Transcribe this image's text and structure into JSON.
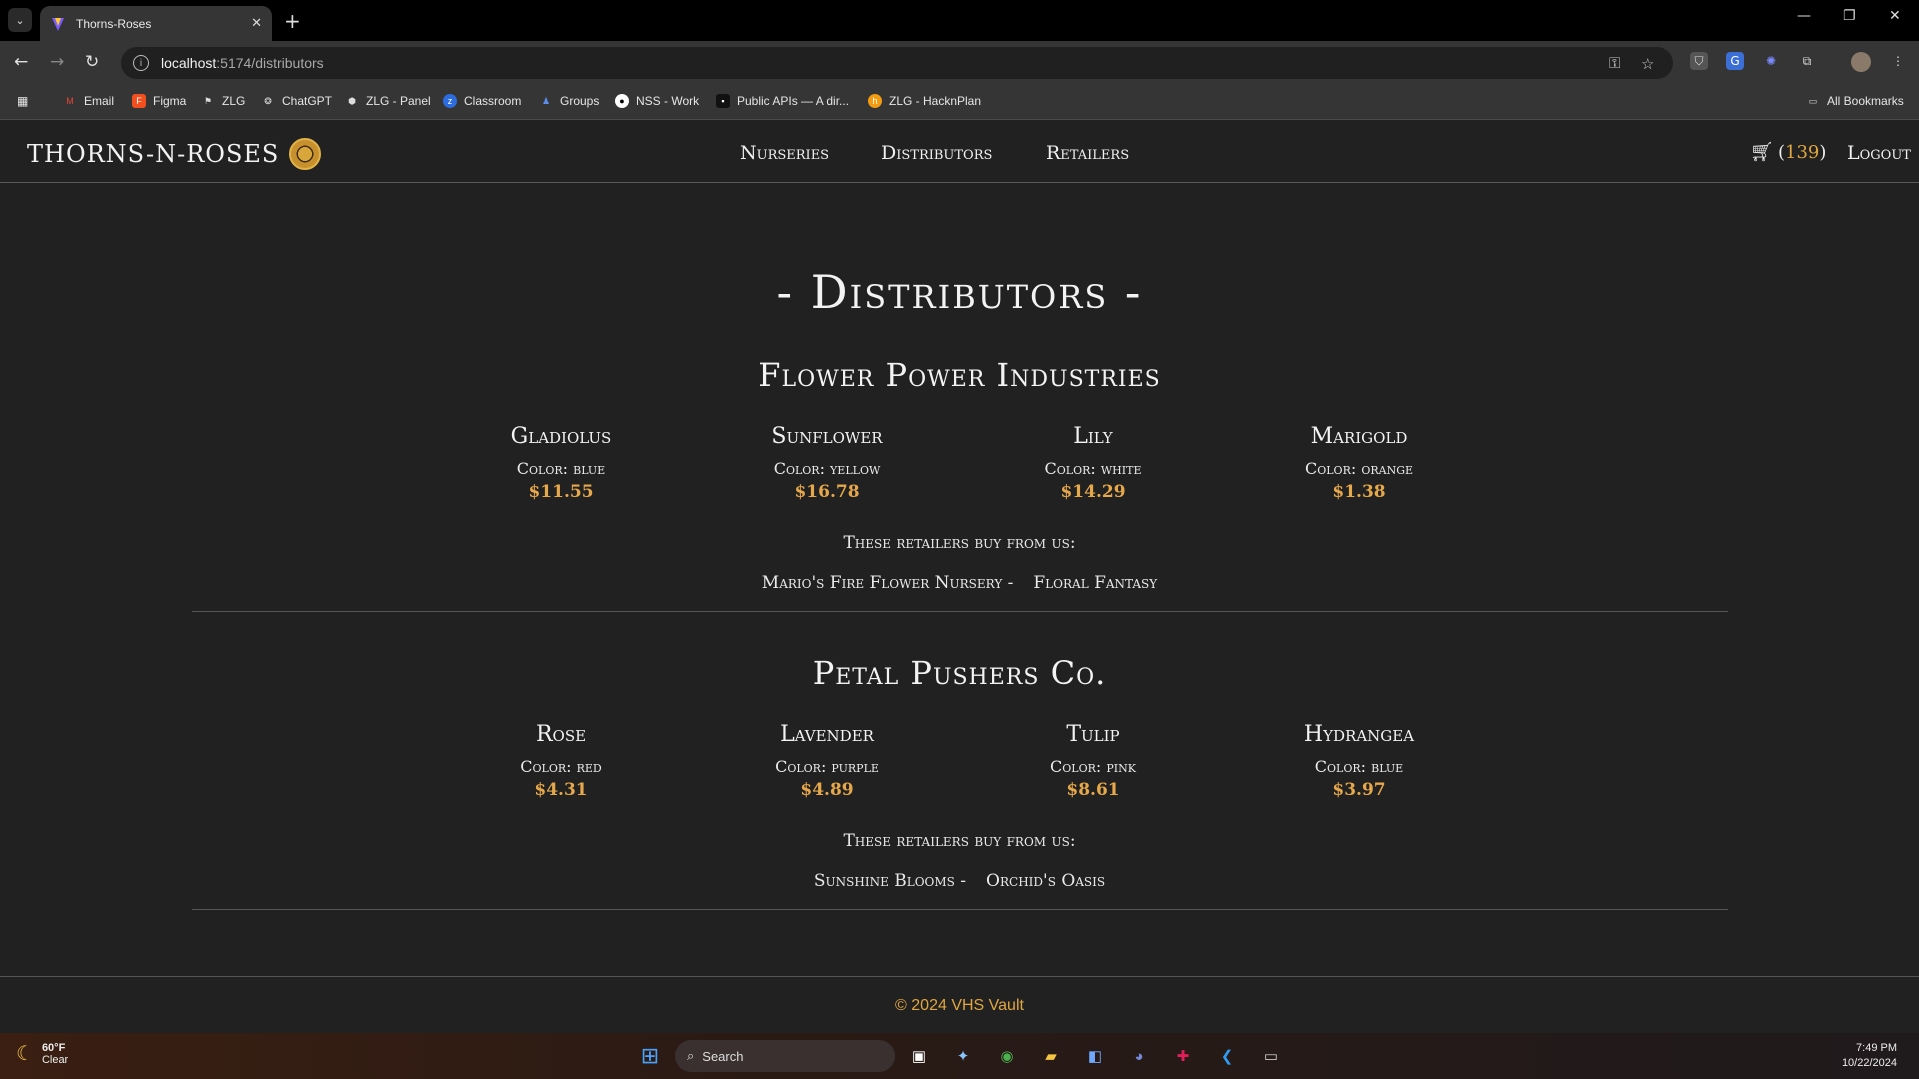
{
  "browser": {
    "tab_title": "Thorns-Roses",
    "url_host": "localhost",
    "url_path": ":5174/distributors",
    "bookmarks": [
      "Email",
      "Figma",
      "ZLG",
      "ChatGPT",
      "ZLG - Panel",
      "Classroom",
      "Groups",
      "NSS - Work",
      "Public APIs — A dir...",
      "ZLG - HacknPlan"
    ],
    "all_bookmarks": "All Bookmarks"
  },
  "site": {
    "brand": "THORNS-N-ROSES",
    "nav": [
      "Nurseries",
      "Distributors",
      "Retailers"
    ],
    "cart_count": "139",
    "logout": "Logout"
  },
  "page": {
    "title": "- Distributors -",
    "retailers_label": "These retailers buy from us:",
    "distributors": [
      {
        "name": "Flower Power Industries",
        "flowers": [
          {
            "name": "Gladiolus",
            "color": "Color: blue",
            "price": "$11.55"
          },
          {
            "name": "Sunflower",
            "color": "Color: yellow",
            "price": "$16.78"
          },
          {
            "name": "Lily",
            "color": "Color: white",
            "price": "$14.29"
          },
          {
            "name": "Marigold",
            "color": "Color: orange",
            "price": "$1.38"
          }
        ],
        "retailers": [
          "Mario's Fire Flower Nursery -",
          "Floral Fantasy"
        ]
      },
      {
        "name": "Petal Pushers Co.",
        "flowers": [
          {
            "name": "Rose",
            "color": "Color: red",
            "price": "$4.31"
          },
          {
            "name": "Lavender",
            "color": "Color: purple",
            "price": "$4.89"
          },
          {
            "name": "Tulip",
            "color": "Color: pink",
            "price": "$8.61"
          },
          {
            "name": "Hydrangea",
            "color": "Color: blue",
            "price": "$3.97"
          }
        ],
        "retailers": [
          "Sunshine Blooms -",
          "Orchid's Oasis"
        ]
      }
    ],
    "footer": "© 2024 VHS Vault"
  },
  "taskbar": {
    "temp": "60°F",
    "weather": "Clear",
    "search_placeholder": "Search",
    "time": "7:49 PM",
    "date": "10/22/2024"
  },
  "colors": {
    "accent": "#e6a84a",
    "page_bg": "#212121"
  }
}
